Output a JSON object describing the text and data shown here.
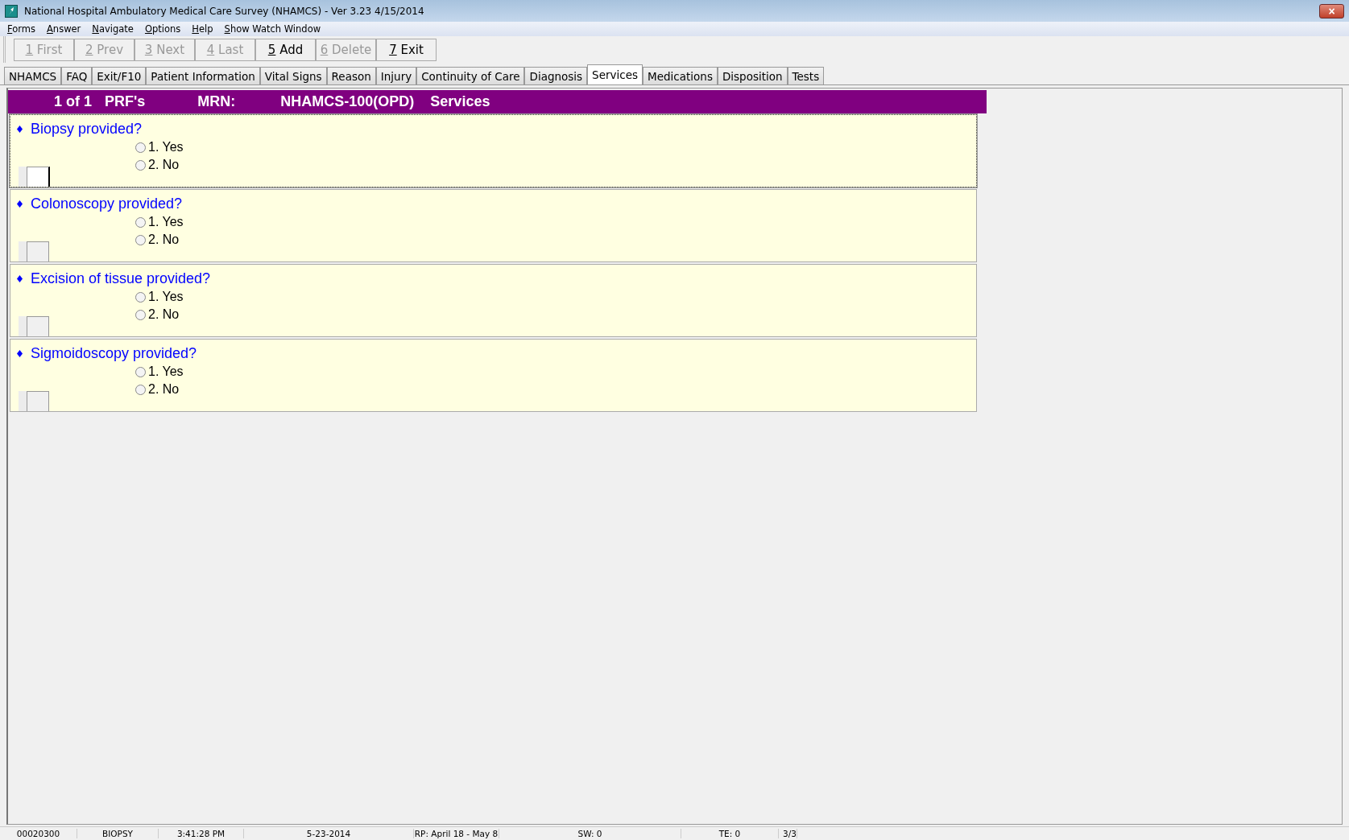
{
  "window": {
    "title": "National Hospital Ambulatory Medical Care Survey (NHAMCS) - Ver 3.23 4/15/2014",
    "close": "×"
  },
  "menu": [
    "Forms",
    "Answer",
    "Navigate",
    "Options",
    "Help",
    "Show Watch Window"
  ],
  "toolbar": [
    {
      "label": "1 First",
      "disabled": true
    },
    {
      "label": "2 Prev",
      "disabled": true
    },
    {
      "label": "3 Next",
      "disabled": true
    },
    {
      "label": "4 Last",
      "disabled": true
    },
    {
      "label": "5 Add",
      "disabled": false
    },
    {
      "label": "6 Delete",
      "disabled": true
    },
    {
      "label": "7 Exit",
      "disabled": false
    }
  ],
  "tabs": [
    {
      "label": "NHAMCS",
      "selected": false
    },
    {
      "label": "FAQ",
      "selected": false
    },
    {
      "label": "Exit/F10",
      "selected": false
    },
    {
      "label": "Patient Information",
      "selected": false
    },
    {
      "label": "Vital Signs",
      "selected": false
    },
    {
      "label": "Reason",
      "selected": false
    },
    {
      "label": "Injury",
      "selected": false
    },
    {
      "label": "Continuity of Care",
      "selected": false
    },
    {
      "label": "Diagnosis",
      "selected": false
    },
    {
      "label": "Services",
      "selected": true
    },
    {
      "label": "Medications",
      "selected": false
    },
    {
      "label": "Disposition",
      "selected": false
    },
    {
      "label": "Tests",
      "selected": false
    }
  ],
  "header": {
    "record": "1 of 1",
    "form": "PRF's",
    "mrn_label": "MRN:",
    "mrn": "NHAMCS-100(OPD)",
    "section": "Services"
  },
  "questions": [
    {
      "text": "Biopsy provided?",
      "focused": true,
      "options": [
        {
          "label": "1. Yes",
          "selected": false
        },
        {
          "label": "2. No",
          "selected": false
        }
      ]
    },
    {
      "text": "Colonoscopy provided?",
      "focused": false,
      "options": [
        {
          "label": "1. Yes",
          "selected": false
        },
        {
          "label": "2. No",
          "selected": false
        }
      ]
    },
    {
      "text": "Excision of tissue provided?",
      "focused": false,
      "options": [
        {
          "label": "1. Yes",
          "selected": false
        },
        {
          "label": "2. No",
          "selected": false
        }
      ]
    },
    {
      "text": "Sigmoidoscopy provided?",
      "focused": false,
      "options": [
        {
          "label": "1. Yes",
          "selected": false
        },
        {
          "label": "2. No",
          "selected": false
        }
      ]
    }
  ],
  "status_bar": [
    "00020300",
    "BIOPSY",
    "3:41:28 PM",
    "5-23-2014",
    "RP: April 18  - May 8",
    "SW: 0",
    "TE: 0",
    "3/3"
  ]
}
